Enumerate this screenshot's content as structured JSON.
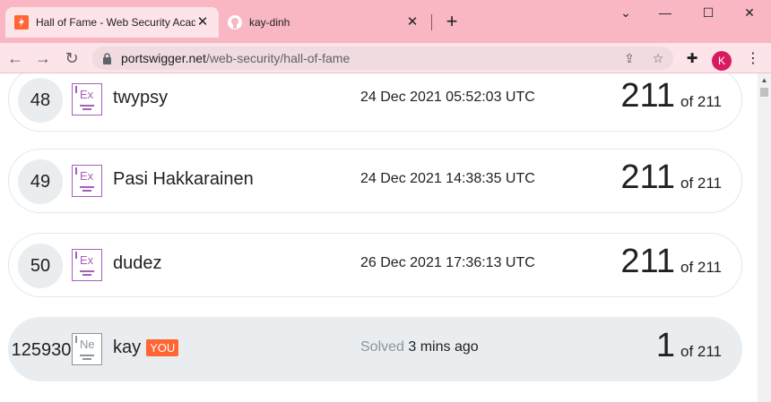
{
  "browser": {
    "tabs": [
      {
        "title": "Hall of Fame - Web Security Acad",
        "active": true
      },
      {
        "title": "kay-dinh",
        "active": false
      }
    ],
    "url_host": "portswigger.net",
    "url_path": "/web-security/hall-of-fame",
    "profile_initial": "K"
  },
  "hall_of_fame": {
    "entries": [
      {
        "rank": "48",
        "level": "Ex",
        "name": "twypsy",
        "date": "24 Dec 2021 05:52:03 UTC",
        "solved": "211",
        "of_total": "of 211"
      },
      {
        "rank": "49",
        "level": "Ex",
        "name": "Pasi Hakkarainen",
        "date": "24 Dec 2021 14:38:35 UTC",
        "solved": "211",
        "of_total": "of 211"
      },
      {
        "rank": "50",
        "level": "Ex",
        "name": "dudez",
        "date": "26 Dec 2021 17:36:13 UTC",
        "solved": "211",
        "of_total": "of 211"
      }
    ],
    "you": {
      "rank": "125930",
      "level": "Ne",
      "name": "kay",
      "badge": "YOU",
      "solved_label": "Solved",
      "solved_time": "3 mins ago",
      "solved": "1",
      "of_total": "of 211"
    }
  },
  "colors": {
    "accent": "#ff6633",
    "tab_bar": "#f8b7c2",
    "expert": "#a55fb8",
    "row_bg": "#e9edf0"
  }
}
